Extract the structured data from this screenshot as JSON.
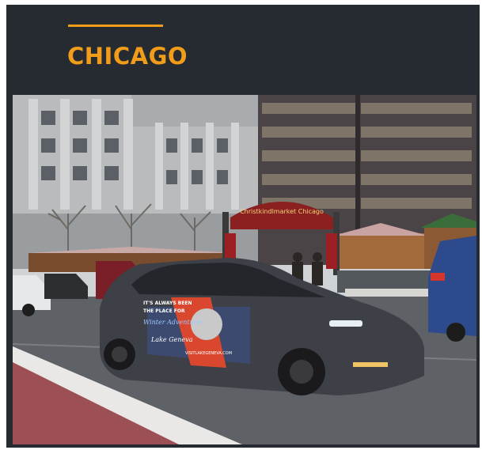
{
  "card": {
    "title": "CHICAGO",
    "accent_color": "#f29d1a",
    "background_color": "#262b31"
  },
  "photo": {
    "market_sign": "Christkindlmarket Chicago",
    "car_wrap": {
      "headline_1": "IT'S ALWAYS BEEN",
      "headline_2": "THE PLACE FOR",
      "script_line": "Winter Adventures",
      "brand": "Lake Geneva",
      "url": "VISITLAKEGENEVA.COM"
    }
  }
}
